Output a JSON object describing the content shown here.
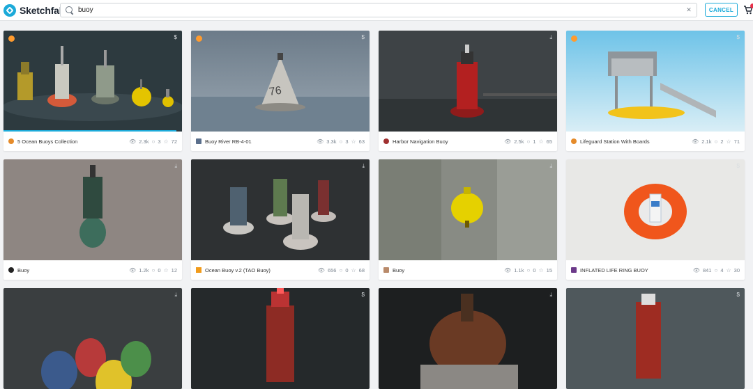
{
  "brand": {
    "name": "Sketchfab",
    "accent": "#1caad9"
  },
  "search": {
    "value": "buoy",
    "clear_icon": "close-icon",
    "cancel_label": "CANCEL"
  },
  "cart": {
    "icon": "cart-icon"
  },
  "results": [
    {
      "title": "5 Ocean Buoys Collection",
      "views": "2.3k",
      "comments": "3",
      "likes": "72",
      "corner": "$",
      "staff_pick": true,
      "progress": 0.97
    },
    {
      "title": "Buoy River RB-4-01",
      "views": "3.3k",
      "comments": "3",
      "likes": "63",
      "corner": "$",
      "staff_pick": true
    },
    {
      "title": "Harbor Navigation Buoy",
      "views": "2.5k",
      "comments": "1",
      "likes": "65",
      "corner": "download",
      "staff_pick": false
    },
    {
      "title": "Lifeguard Station With Boards",
      "views": "2.1k",
      "comments": "2",
      "likes": "71",
      "corner": "$",
      "staff_pick": true
    },
    {
      "title": "Buoy",
      "views": "1.2k",
      "comments": "0",
      "likes": "12",
      "corner": "download",
      "staff_pick": false
    },
    {
      "title": "Ocean Buoy v.2 (TAO Buoy)",
      "views": "656",
      "comments": "0",
      "likes": "68",
      "corner": "download",
      "staff_pick": false
    },
    {
      "title": "Buoy",
      "views": "1.1k",
      "comments": "0",
      "likes": "15",
      "corner": "download",
      "staff_pick": false
    },
    {
      "title": "INFLATED LIFE RING BUOY",
      "views": "841",
      "comments": "4",
      "likes": "30",
      "corner": "$",
      "staff_pick": false
    },
    {
      "title": "",
      "corner": "download"
    },
    {
      "title": "",
      "corner": "$"
    },
    {
      "title": "",
      "corner": "download"
    },
    {
      "title": "",
      "corner": "$"
    }
  ]
}
